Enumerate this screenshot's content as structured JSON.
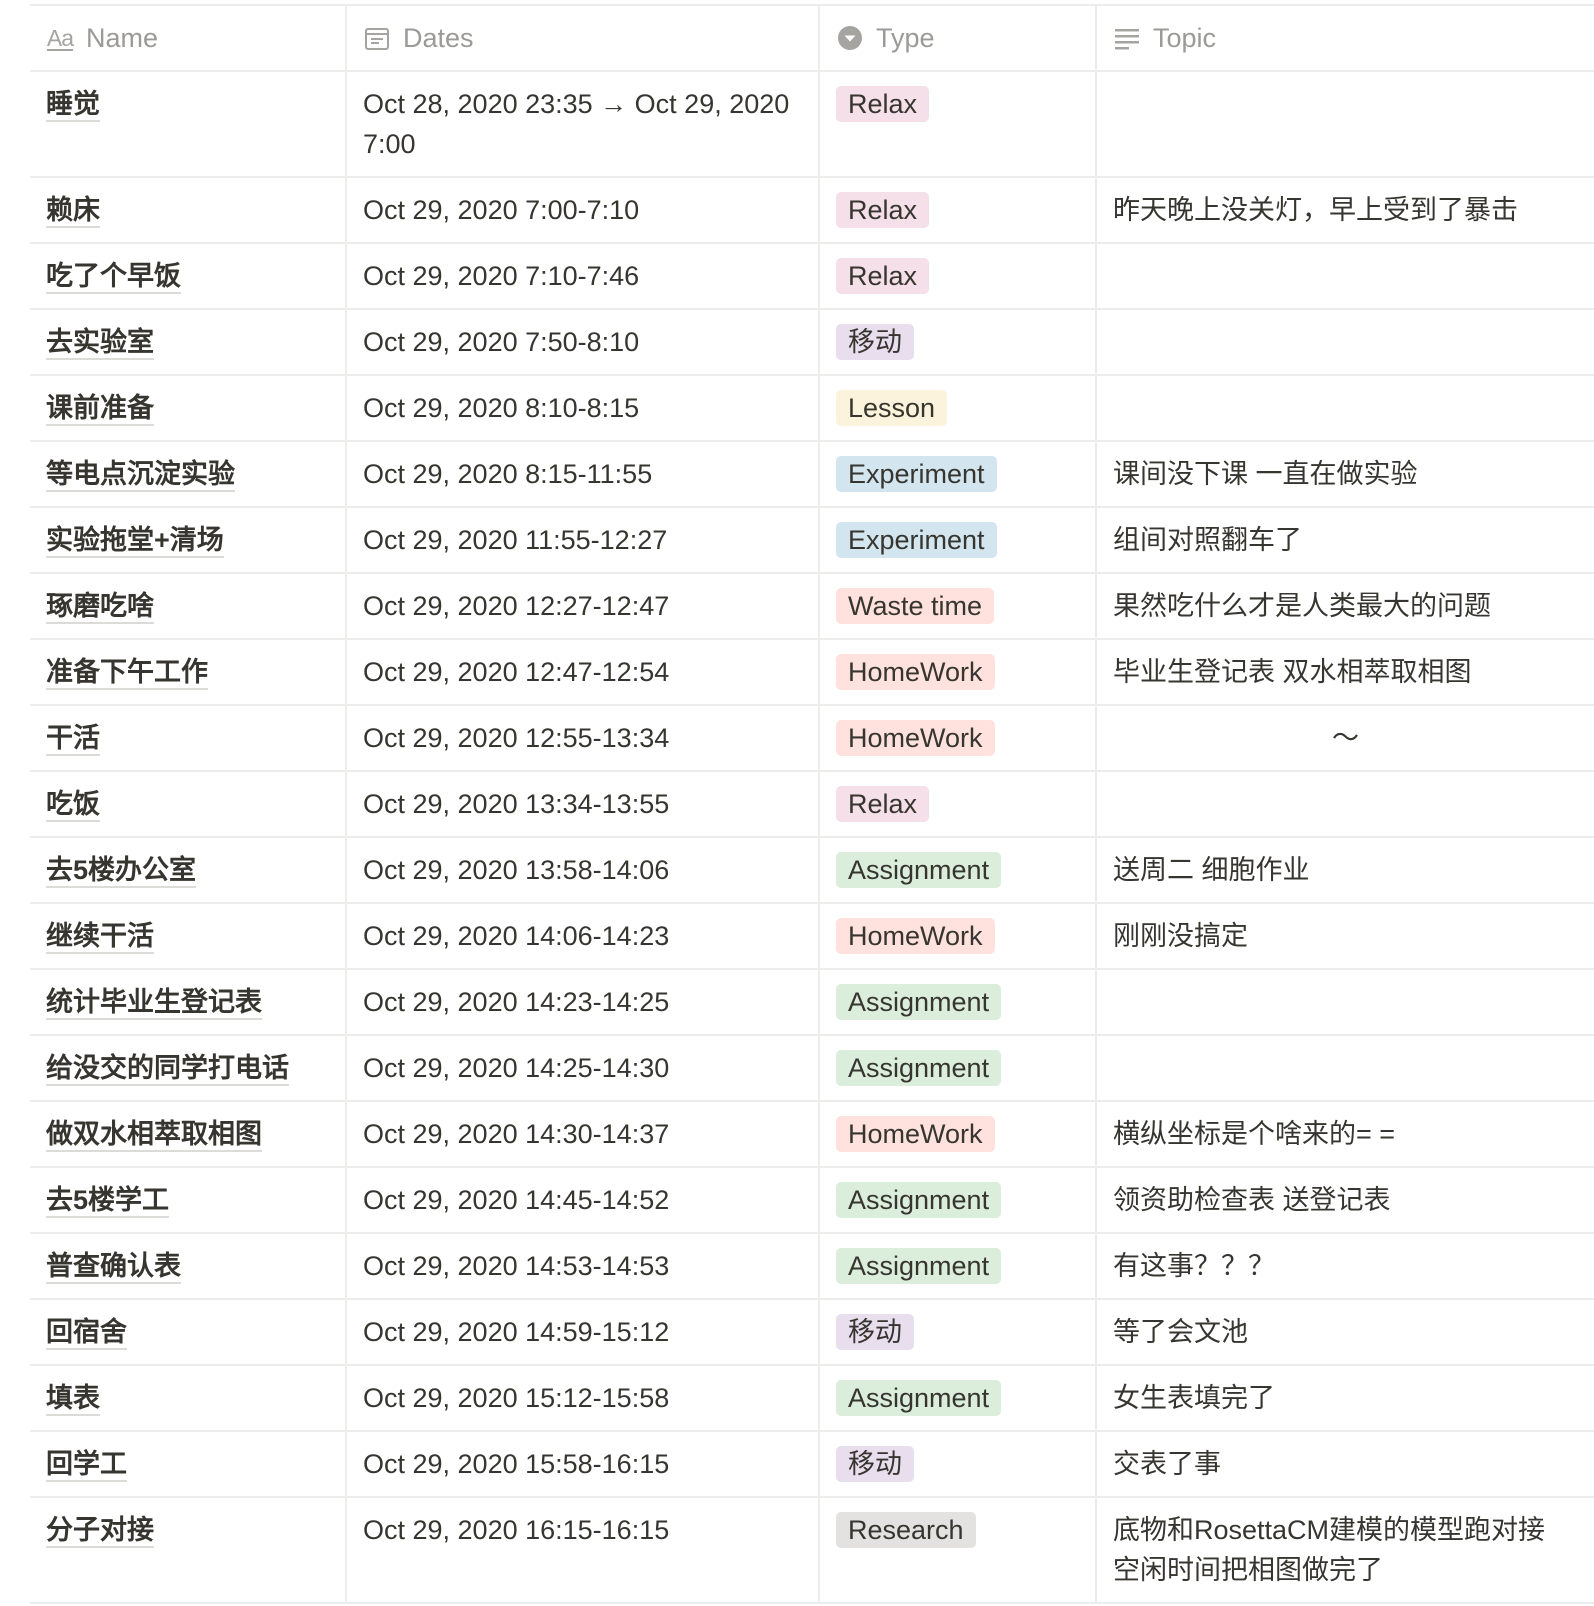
{
  "columns": {
    "name": {
      "label": "Name",
      "icon": "text-property-icon"
    },
    "dates": {
      "label": "Dates",
      "icon": "calendar-icon"
    },
    "type": {
      "label": "Type",
      "icon": "select-property-icon"
    },
    "topic": {
      "label": "Topic",
      "icon": "text-lines-icon"
    }
  },
  "tag_colors": {
    "Relax": "#f5e0e9",
    "移动": "#e8deee",
    "Lesson": "#fbf3db",
    "Experiment": "#d3e5ef",
    "Waste time": "#ffe2dd",
    "HomeWork": "#ffe2dd",
    "Assignment": "#dbeddb",
    "Research": "#e3e2e0"
  },
  "rows": [
    {
      "name": "睡觉",
      "dates": "Oct 28, 2020 23:35 → Oct 29, 2020 7:00",
      "type": "Relax",
      "topic": ""
    },
    {
      "name": "赖床",
      "dates": "Oct 29, 2020 7:00-7:10",
      "type": "Relax",
      "topic": "昨天晚上没关灯，早上受到了暴击"
    },
    {
      "name": "吃了个早饭",
      "dates": "Oct 29, 2020 7:10-7:46",
      "type": "Relax",
      "topic": ""
    },
    {
      "name": "去实验室",
      "dates": "Oct 29, 2020 7:50-8:10",
      "type": "移动",
      "topic": ""
    },
    {
      "name": "课前准备",
      "dates": "Oct 29, 2020 8:10-8:15",
      "type": "Lesson",
      "topic": ""
    },
    {
      "name": "等电点沉淀实验",
      "dates": "Oct 29, 2020 8:15-11:55",
      "type": "Experiment",
      "topic": "课间没下课 一直在做实验"
    },
    {
      "name": "实验拖堂+清场",
      "dates": "Oct 29, 2020 11:55-12:27",
      "type": "Experiment",
      "topic": "组间对照翻车了"
    },
    {
      "name": "琢磨吃啥",
      "dates": "Oct 29, 2020 12:27-12:47",
      "type": "Waste time",
      "topic": "果然吃什么才是人类最大的问题"
    },
    {
      "name": "准备下午工作",
      "dates": "Oct 29, 2020 12:47-12:54",
      "type": "HomeWork",
      "topic": "毕业生登记表 双水相萃取相图"
    },
    {
      "name": "干活",
      "dates": "Oct 29, 2020 12:55-13:34",
      "type": "HomeWork",
      "topic": "～",
      "center": true
    },
    {
      "name": "吃饭",
      "dates": "Oct 29, 2020 13:34-13:55",
      "type": "Relax",
      "topic": ""
    },
    {
      "name": "去5楼办公室",
      "dates": "Oct 29, 2020 13:58-14:06",
      "type": "Assignment",
      "topic": "送周二 细胞作业"
    },
    {
      "name": "继续干活",
      "dates": "Oct 29, 2020 14:06-14:23",
      "type": "HomeWork",
      "topic": "刚刚没搞定"
    },
    {
      "name": "统计毕业生登记表",
      "dates": "Oct 29, 2020 14:23-14:25",
      "type": "Assignment",
      "topic": ""
    },
    {
      "name": "给没交的同学打电话",
      "dates": "Oct 29, 2020 14:25-14:30",
      "type": "Assignment",
      "topic": ""
    },
    {
      "name": "做双水相萃取相图",
      "dates": "Oct 29, 2020 14:30-14:37",
      "type": "HomeWork",
      "topic": "横纵坐标是个啥来的= ="
    },
    {
      "name": "去5楼学工",
      "dates": "Oct 29, 2020 14:45-14:52",
      "type": "Assignment",
      "topic": "领资助检查表 送登记表"
    },
    {
      "name": "普查确认表",
      "dates": "Oct 29, 2020 14:53-14:53",
      "type": "Assignment",
      "topic": "有这事？？？"
    },
    {
      "name": "回宿舍",
      "dates": "Oct 29, 2020 14:59-15:12",
      "type": "移动",
      "topic": "等了会文池"
    },
    {
      "name": "填表",
      "dates": "Oct 29, 2020 15:12-15:58",
      "type": "Assignment",
      "topic": "女生表填完了"
    },
    {
      "name": "回学工",
      "dates": "Oct 29, 2020 15:58-16:15",
      "type": "移动",
      "topic": "交表了事"
    },
    {
      "name": "分子对接",
      "dates": "Oct 29, 2020 16:15-16:15",
      "type": "Research",
      "topic": "底物和RosettaCM建模的模型跑对接 空闲时间把相图做完了"
    }
  ]
}
